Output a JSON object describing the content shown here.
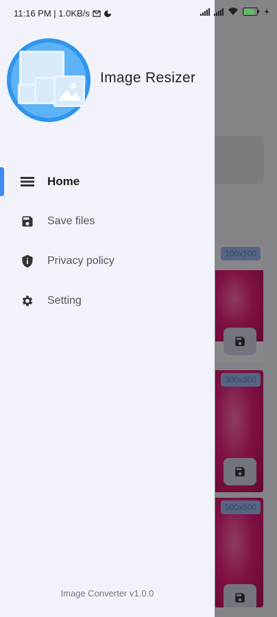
{
  "status_bar": {
    "time_speed": "11:16 PM | 1.0KB/s",
    "battery_percent": 80
  },
  "drawer": {
    "app_name": "Image Resizer",
    "menu": [
      {
        "label": "Home",
        "icon": "list-icon",
        "active": true
      },
      {
        "label": "Save files",
        "icon": "floppy-disk-icon",
        "active": false
      },
      {
        "label": "Privacy policy",
        "icon": "shield-icon",
        "active": false
      },
      {
        "label": "Setting",
        "icon": "gear-icon",
        "active": false
      }
    ],
    "version": "Image Converter v1.0.0"
  },
  "background": {
    "items": [
      {
        "size_label": "100x100"
      },
      {
        "size_label": "300x300"
      },
      {
        "size_label": "500x500"
      }
    ]
  },
  "colors": {
    "accent": "#3f8af5",
    "drawer_bg": "#f2f2fb",
    "logo_blue": "#2f95ee",
    "thumb_pink": "#e8207a"
  }
}
